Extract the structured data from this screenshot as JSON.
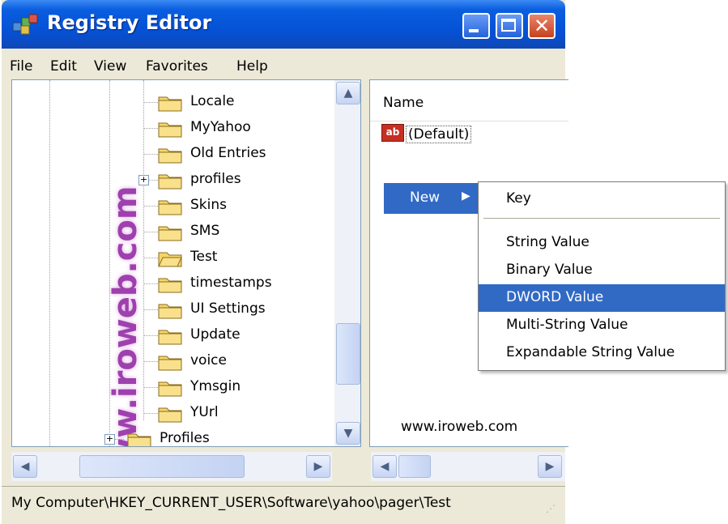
{
  "window": {
    "title": "Registry Editor",
    "close_glyph": "✕"
  },
  "menu": [
    "File",
    "Edit",
    "View",
    "Favorites",
    "Help"
  ],
  "tree": {
    "items": [
      {
        "label": "Locale"
      },
      {
        "label": "MyYahoo"
      },
      {
        "label": "Old Entries"
      },
      {
        "label": "profiles",
        "expander": "+"
      },
      {
        "label": "Skins"
      },
      {
        "label": "SMS"
      },
      {
        "label": "Test",
        "selected": true
      },
      {
        "label": "timestamps"
      },
      {
        "label": "UI Settings"
      },
      {
        "label": "Update"
      },
      {
        "label": "voice"
      },
      {
        "label": "Ymsgin"
      },
      {
        "label": "YUrl"
      }
    ],
    "last_item": {
      "label": "Profiles",
      "expander": "+"
    },
    "watermark": "www.iroweb.com"
  },
  "list": {
    "column_name": "Name",
    "entries": [
      {
        "label": "(Default)",
        "icon_text": "ab"
      }
    ],
    "watermark": "www.iroweb.com"
  },
  "context_menu": {
    "new_label": "New",
    "submenu": {
      "key": "Key",
      "items": [
        "String Value",
        "Binary Value",
        "DWORD Value",
        "Multi-String Value",
        "Expandable String Value"
      ],
      "highlighted": "DWORD Value"
    }
  },
  "status_bar": {
    "path": "My Computer\\HKEY_CURRENT_USER\\Software\\yahoo\\pager\\Test"
  },
  "colors": {
    "titlebar": "#0a5ee0",
    "selection": "#316ac5",
    "folder": "#f5d56b",
    "watermark": "#8e1fa0"
  },
  "icons": [
    "registry-app-icon",
    "minimize-icon",
    "maximize-icon",
    "close-icon",
    "folder-icon",
    "open-folder-icon",
    "string-value-icon",
    "scroll-up-icon",
    "scroll-down-icon",
    "scroll-left-icon",
    "scroll-right-icon",
    "submenu-arrow-icon",
    "size-grip-icon"
  ]
}
